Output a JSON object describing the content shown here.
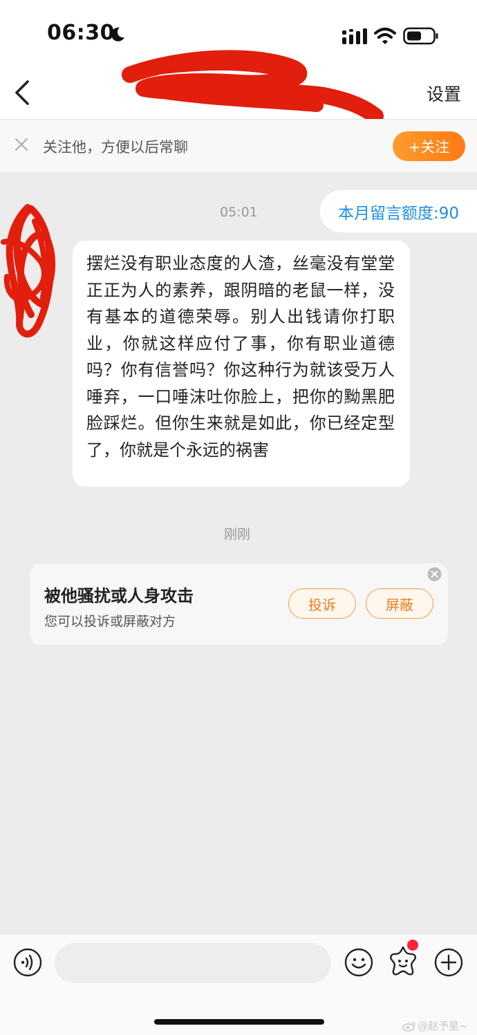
{
  "status_bar": {
    "time": "06:30"
  },
  "header": {
    "settings_label": "设置"
  },
  "follow_bar": {
    "tip": "关注他，方便以后常聊",
    "follow_label": "+关注"
  },
  "chat": {
    "quota_label": "本月留言额度:90",
    "time_first": "05:01",
    "message": "摆烂没有职业态度的人渣，丝毫没有堂堂正正为人的素养，跟阴暗的老鼠一样，没有基本的道德荣辱。别人出钱请你打职业，你就这样应付了事，你有职业道德吗？你有信誉吗？你这种行为就该受万人唾弃，一口唾沫吐你脸上，把你的黝黑肥脸踩烂。但你生来就是如此，你已经定型了，你就是个永远的祸害",
    "time_second": "刚刚"
  },
  "harass_card": {
    "title": "被他骚扰或人身攻击",
    "subtitle": "您可以投诉或屏蔽对方",
    "report_label": "投诉",
    "block_label": "屏蔽"
  },
  "input_bar": {
    "placeholder": ""
  },
  "watermark": {
    "text": "@赵予星~"
  },
  "colors": {
    "accent": "#ff8a1f",
    "link": "#1d8fe6",
    "redaction": "#e21e0c"
  }
}
